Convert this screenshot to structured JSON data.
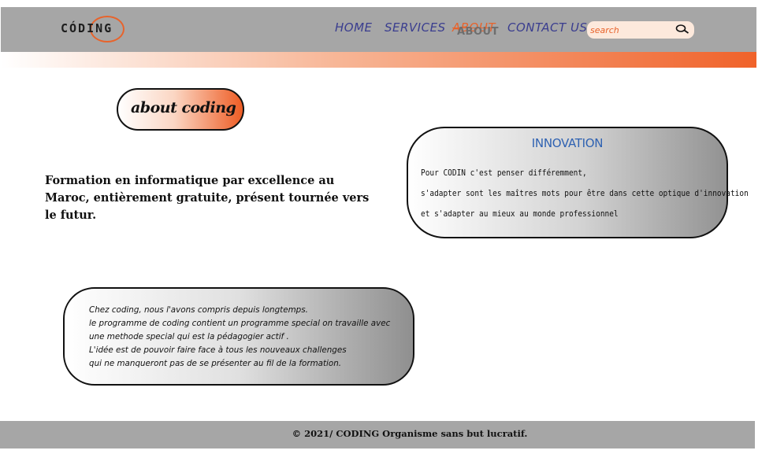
{
  "brand": {
    "logo_text": "CÓDING"
  },
  "nav": {
    "home": "HOME",
    "services": "SERVICES",
    "about": "ABOUT",
    "about_shadow": "ABOUT",
    "contact": "CONTACT US"
  },
  "search": {
    "placeholder": "search",
    "icon": "search-icon"
  },
  "about": {
    "pill_label": "about coding"
  },
  "intro": {
    "text": "Formation en informatique par excellence au Maroc, entièrement gratuite, présent tournée vers le futur."
  },
  "innovation": {
    "title": "INNOVATION",
    "lines": [
      "Pour CODIN c'est penser différemment,",
      " s'adapter sont les maîtres mots pour être dans cette optique d'innovation",
      "  et s'adapter au mieux au monde professionnel"
    ]
  },
  "coding_card": {
    "lines": [
      "Chez coding, nous l'avons compris depuis longtemps.",
      "le programme de coding contient un programme special on travaille avec",
      "une methode special qui est la pédagogier actif .",
      "L'idée est de pouvoir faire face à tous les nouveaux challenges",
      "qui ne manqueront pas de se présenter au fil de la formation."
    ]
  },
  "footer": {
    "text": "© 2021/ CODING Organisme sans but lucratif."
  },
  "colors": {
    "accent": "#e8632b",
    "nav_text": "#3a3d8f",
    "header_bg": "#a6a6a6",
    "innovation_title": "#2f62b2"
  }
}
